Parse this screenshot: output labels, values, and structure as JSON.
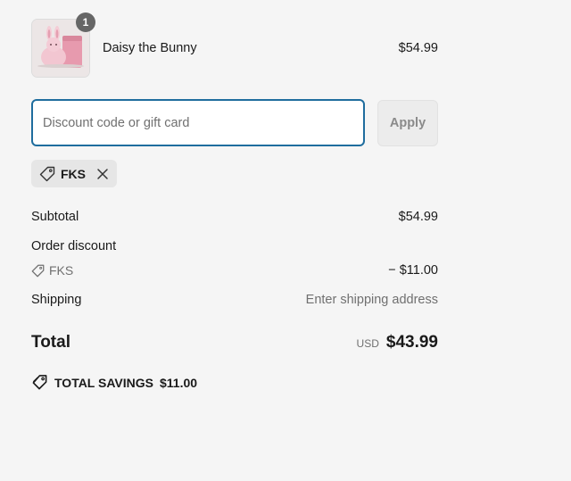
{
  "product": {
    "name": "Daisy the Bunny",
    "price": "$54.99",
    "quantity": "1",
    "image_icon": "bunny-candle-image"
  },
  "discount": {
    "placeholder": "Discount code or gift card",
    "value": "",
    "apply_label": "Apply",
    "applied_code": "FKS"
  },
  "totals": {
    "subtotal_label": "Subtotal",
    "subtotal_value": "$54.99",
    "order_discount_label": "Order discount",
    "discount_code": "FKS",
    "discount_value": "− $11.00",
    "shipping_label": "Shipping",
    "shipping_value": "Enter shipping address",
    "total_label": "Total",
    "currency": "USD",
    "total_value": "$43.99",
    "savings_label": "TOTAL SAVINGS",
    "savings_value": "$11.00"
  },
  "colors": {
    "page_bg": "#f5f5f5",
    "input_focus_border": "#1f6d9e",
    "badge_bg": "#666666"
  }
}
